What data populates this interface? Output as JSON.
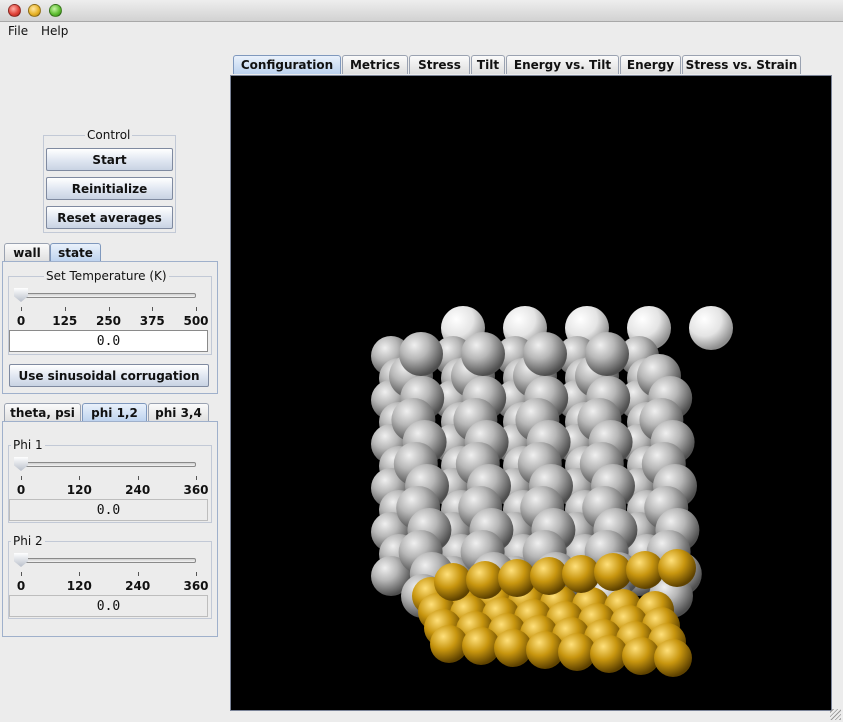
{
  "menu": {
    "file": "File",
    "help": "Help"
  },
  "control": {
    "title": "Control",
    "start": "Start",
    "reinitialize": "Reinitialize",
    "reset_averages": "Reset averages"
  },
  "left_tabs": {
    "wall": "wall",
    "state": "state",
    "active": "state"
  },
  "state_panel": {
    "temperature": {
      "title": "Set Temperature (K)",
      "ticks": [
        "0",
        "125",
        "250",
        "375",
        "500"
      ],
      "value": "0.0",
      "slider_fraction": 0
    },
    "corrugation_button": "Use sinusoidal corrugation"
  },
  "angle_tabs": {
    "theta_psi": "theta, psi",
    "phi12": "phi 1,2",
    "phi34": "phi 3,4",
    "active": "phi 1,2"
  },
  "phi_panel": {
    "phi1": {
      "title": "Phi 1",
      "ticks": [
        "0",
        "120",
        "240",
        "360"
      ],
      "value": "0.0",
      "slider_fraction": 0
    },
    "phi2": {
      "title": "Phi 2",
      "ticks": [
        "0",
        "120",
        "240",
        "360"
      ],
      "value": "0.0",
      "slider_fraction": 0
    }
  },
  "main_tabs": [
    "Configuration",
    "Metrics",
    "Stress",
    "Tilt",
    "Energy vs. Tilt",
    "Energy",
    "Stress vs. Strain"
  ],
  "main_tab_active": "Configuration",
  "colors": {
    "canvas_bg": "#000000",
    "chain_atom": "#b8b8b8",
    "chain_end_atom": "#f2f2f2",
    "surface_atom": "#c89a16",
    "tab_active": "#bcd2ee"
  }
}
